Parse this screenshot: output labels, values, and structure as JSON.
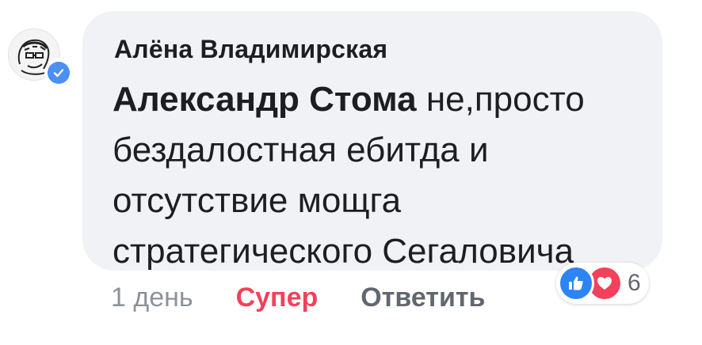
{
  "comment": {
    "author": "Алёна Владимирская",
    "mention": "Александр Стома",
    "text": " не,просто бездалостная ебитда и отсутствие мощга стратегического Сегаловича"
  },
  "actions": {
    "time": "1 день",
    "react_label": "Супер",
    "reply_label": "Ответить"
  },
  "reactions": {
    "icons": [
      "like-icon",
      "love-icon"
    ],
    "count": "6"
  },
  "colors": {
    "bubble": "#f1f2f6",
    "react_active": "#f2415a",
    "like": "#2d84f5",
    "love": "#f2415a",
    "verified": "#4b8ff7"
  }
}
